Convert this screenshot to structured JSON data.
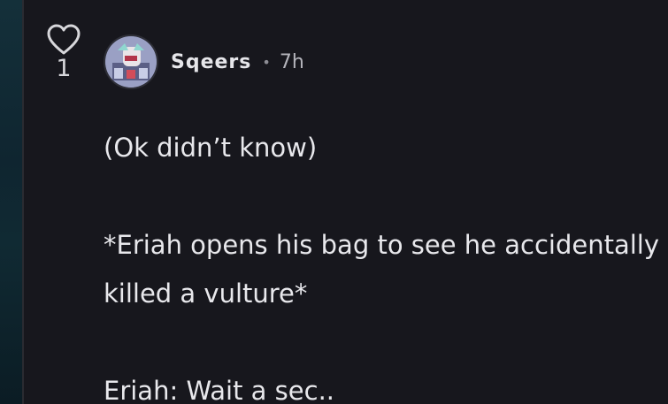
{
  "comment": {
    "likes": "1",
    "author": "Sqeers",
    "separator": "•",
    "time": "7h",
    "lines": {
      "l1": "(Ok didn’t know)",
      "l2": "*Eriah opens his bag to see he accidentally",
      "l3": "killed a vulture*",
      "l4": "Eriah: Wait a sec.."
    }
  },
  "icons": {
    "like": "heart-outline-icon"
  },
  "colors": {
    "background": "#17171d",
    "text": "#e8e8ec",
    "muted": "#b4b4bb",
    "left_strip": "#0f2530"
  }
}
